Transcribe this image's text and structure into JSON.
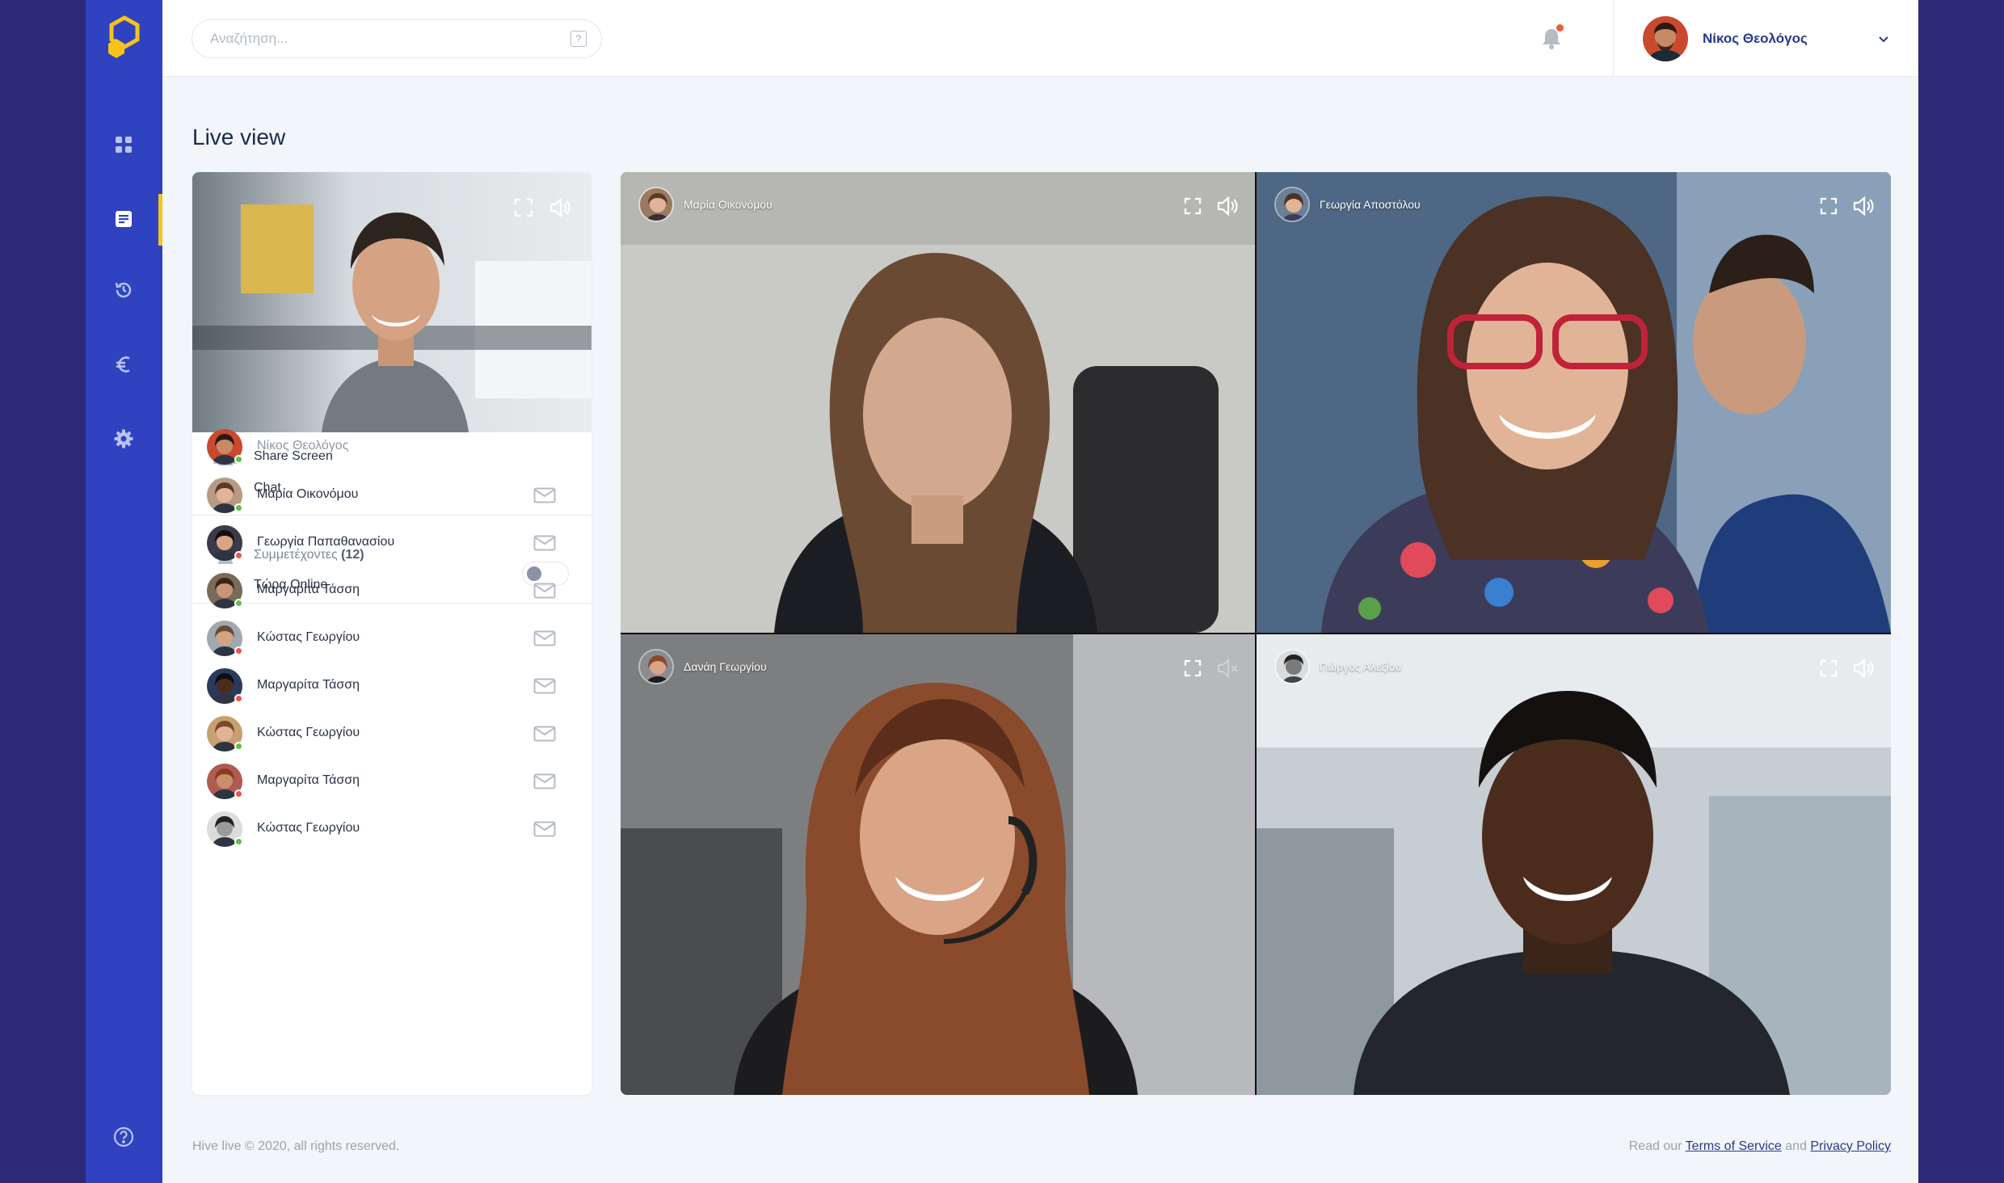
{
  "search": {
    "placeholder": "Αναζήτηση...",
    "shortcut": "?"
  },
  "user": {
    "name": "Νίκος Θεολόγος"
  },
  "page": {
    "title": "Live view"
  },
  "sidebar": {
    "items": [
      {
        "icon": "grid-icon"
      },
      {
        "icon": "document-icon",
        "active": true
      },
      {
        "icon": "history-icon"
      },
      {
        "icon": "euro-icon"
      },
      {
        "icon": "gear-icon"
      }
    ],
    "help_icon": "help-icon",
    "active_color": "#f8c318"
  },
  "panel": {
    "share_screen": "Share Screen",
    "chat": "Chat",
    "participants_label": "Συμμετέχοντες",
    "participants_count": "(12)",
    "online_now": "Τώρα Online",
    "online_toggle_on": false
  },
  "participants": [
    {
      "name": "Νίκος Θεολόγος",
      "status": "online",
      "self": true
    },
    {
      "name": "Μαρία Οικονόμου",
      "status": "online"
    },
    {
      "name": "Γεωργία Παπαθανασίου",
      "status": "busy"
    },
    {
      "name": "Μαργαρίτα Τάσση",
      "status": "online"
    },
    {
      "name": "Κώστας Γεωργίου",
      "status": "busy"
    },
    {
      "name": "Μαργαρίτα Τάσση",
      "status": "busy"
    },
    {
      "name": "Κώστας Γεωργίου",
      "status": "online"
    },
    {
      "name": "Μαργαρίτα Τάσση",
      "status": "busy"
    },
    {
      "name": "Κώστας Γεωργίου",
      "status": "online"
    }
  ],
  "videos": [
    {
      "name": "Μαρία Οικονόμου",
      "muted": false
    },
    {
      "name": "Γεωργία Αποστόλου",
      "muted": false
    },
    {
      "name": "Δανάη Γεωργίου",
      "muted": true
    },
    {
      "name": "Γιώργος Αλεξίου",
      "muted": false
    }
  ],
  "footer": {
    "copyright": "Hive live © 2020, all rights reserved.",
    "read_our": "Read our",
    "terms": "Terms of Service",
    "and": "and",
    "privacy": "Privacy Policy"
  },
  "colors": {
    "brand": "#2f43c0",
    "accent": "#f8c318",
    "online": "#5cc245",
    "busy": "#f25148",
    "background": "#2c2a78"
  }
}
